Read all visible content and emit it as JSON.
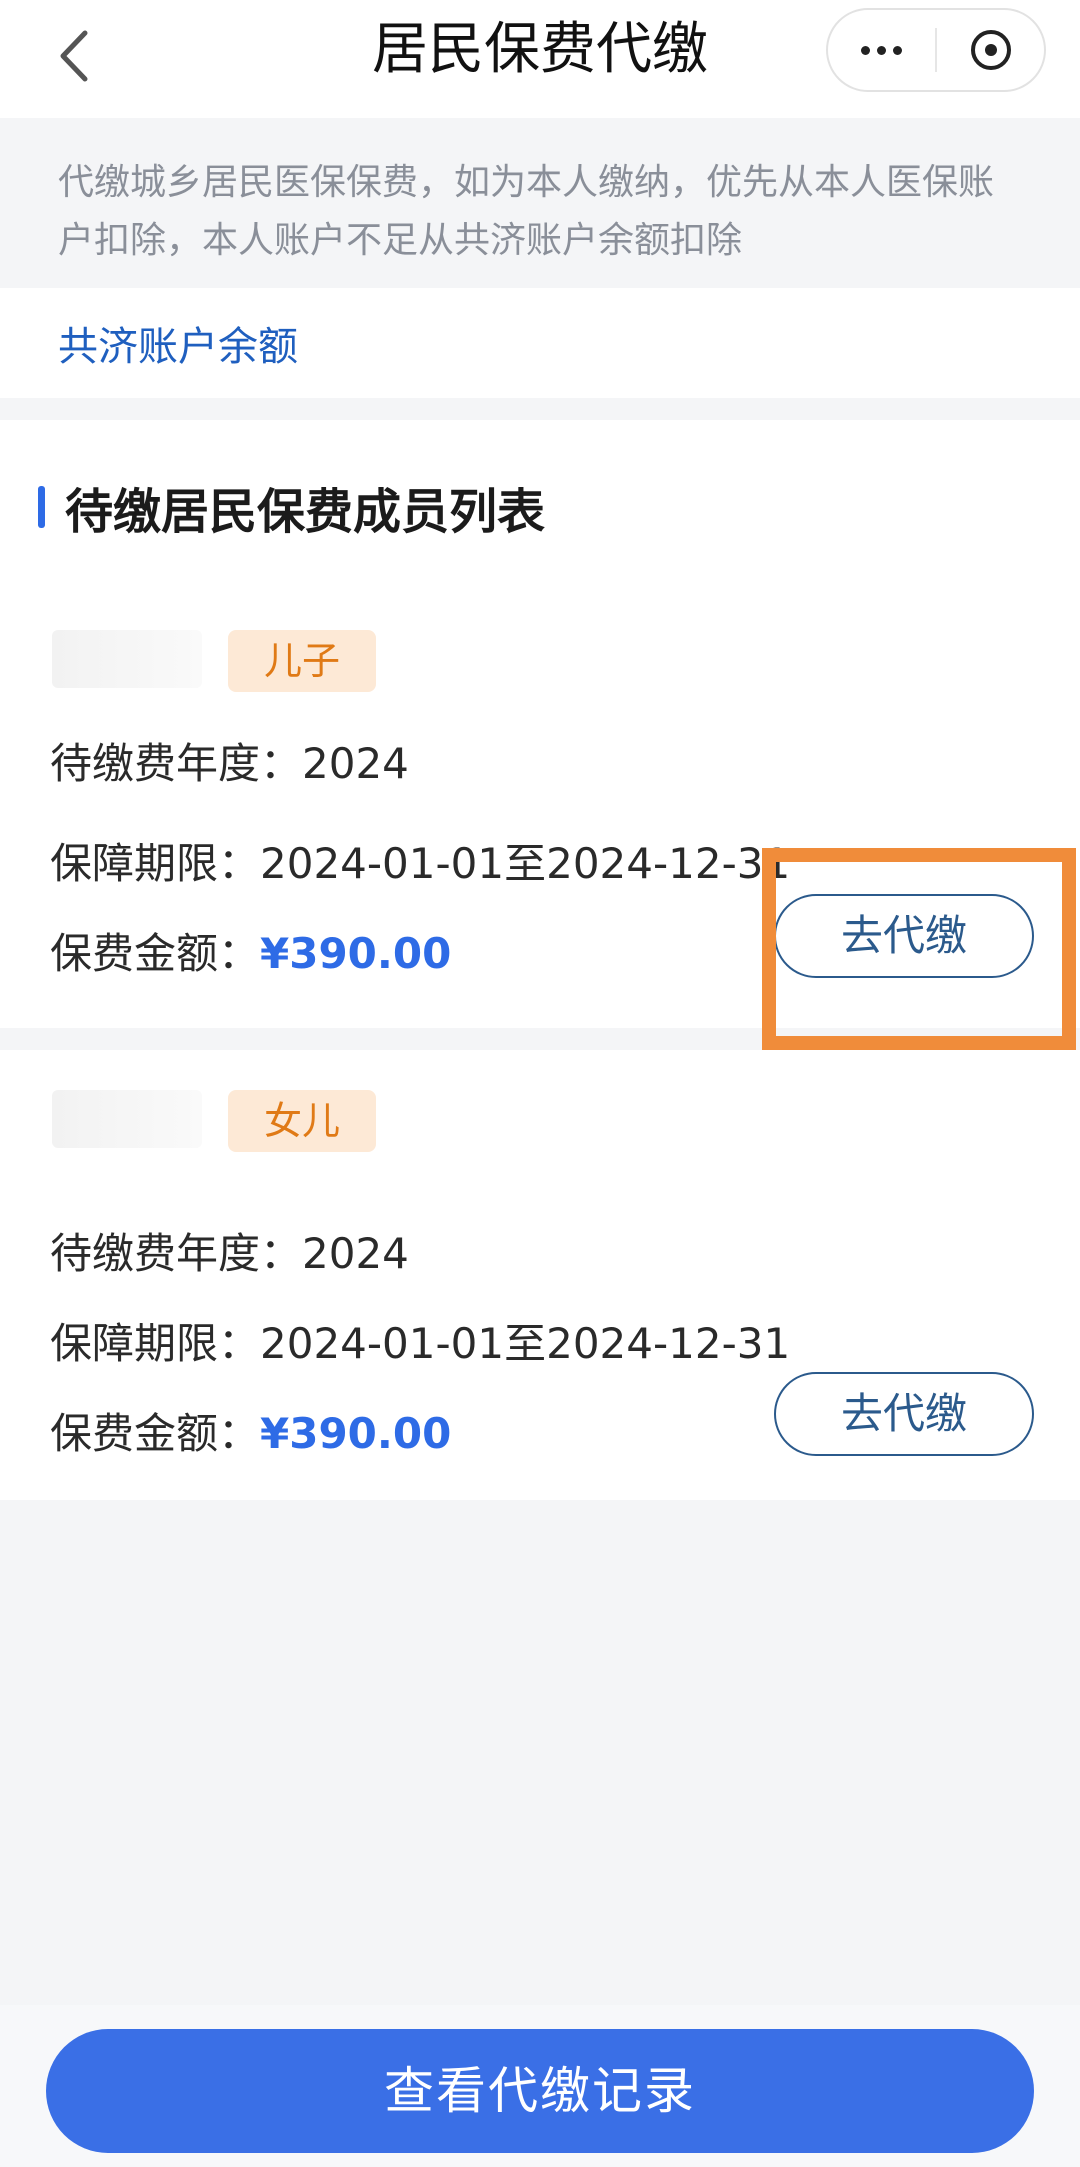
{
  "nav": {
    "title": "居民保费代缴",
    "back_icon": "chevron-left-icon",
    "more_icon": "more-dots-icon",
    "close_icon": "close-circle-icon"
  },
  "notice": {
    "text": "代缴城乡居民医保保费，如为本人缴纳，优先从本人医保账户扣除，本人账户不足从共济账户余额扣除"
  },
  "balance": {
    "label": "共济账户余额"
  },
  "section": {
    "title": "待缴居民保费成员列表"
  },
  "members": [
    {
      "relation": "儿子",
      "year_label": "待缴费年度：",
      "year": "2024",
      "period_label": "保障期限：",
      "period": "2024-01-01至2024-12-31",
      "amount_label": "保费金额：",
      "amount": "¥390.00",
      "button": "去代缴"
    },
    {
      "relation": "女儿",
      "year_label": "待缴费年度：",
      "year": "2024",
      "period_label": "保障期限：",
      "period": "2024-01-01至2024-12-31",
      "amount_label": "保费金额：",
      "amount": "¥390.00",
      "button": "去代缴"
    }
  ],
  "footer": {
    "button": "查看代缴记录"
  },
  "colors": {
    "accent": "#3a6fe6",
    "link": "#1f5fbf",
    "price": "#2e6be6",
    "tag_bg": "#fde9d6",
    "tag_text": "#e07a16",
    "highlight": "#f08c3a"
  }
}
